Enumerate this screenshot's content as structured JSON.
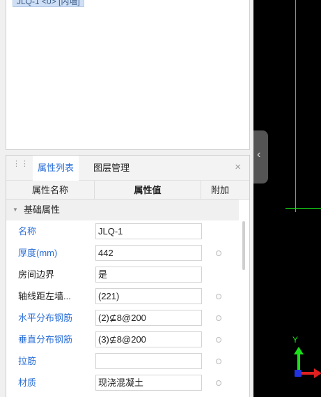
{
  "list": {
    "selected_item": "JLQ-1 <0> [内墙]"
  },
  "panel": {
    "tabs": [
      {
        "label": "属性列表",
        "active": true
      },
      {
        "label": "图层管理",
        "active": false
      }
    ],
    "close_glyph": "×",
    "grip_glyph": "⋮⋮"
  },
  "table": {
    "headers": {
      "name": "属性名称",
      "value": "属性值",
      "extra": "附加"
    },
    "group": {
      "caret": "▼",
      "label": "基础属性"
    },
    "rows": [
      {
        "name": "名称",
        "value": "JLQ-1",
        "name_color": "blue",
        "has_extra": false
      },
      {
        "name": "厚度(mm)",
        "value": "442",
        "name_color": "blue",
        "has_extra": true
      },
      {
        "name": "房间边界",
        "value": "是",
        "name_color": "black",
        "has_extra": false
      },
      {
        "name": "轴线距左墙...",
        "value": "(221)",
        "name_color": "black",
        "has_extra": true
      },
      {
        "name": "水平分布钢筋",
        "value": "(2)⊈8@200",
        "name_color": "blue",
        "has_extra": true
      },
      {
        "name": "垂直分布钢筋",
        "value": "(3)⊈8@200",
        "name_color": "blue",
        "has_extra": true
      },
      {
        "name": "拉筋",
        "value": "",
        "name_color": "blue",
        "has_extra": true
      },
      {
        "name": "材质",
        "value": "现浇混凝土",
        "name_color": "blue",
        "has_extra": true
      }
    ]
  },
  "splitter": {
    "glyph": "‹"
  },
  "canvas": {
    "axis_label": "Y",
    "colors": {
      "background": "#000000",
      "line": "#19e019",
      "x_axis": "#e02020",
      "origin": "#2233dd"
    }
  },
  "colors": {
    "accent": "#2b6fd8",
    "selection": "#cfe0f6"
  }
}
